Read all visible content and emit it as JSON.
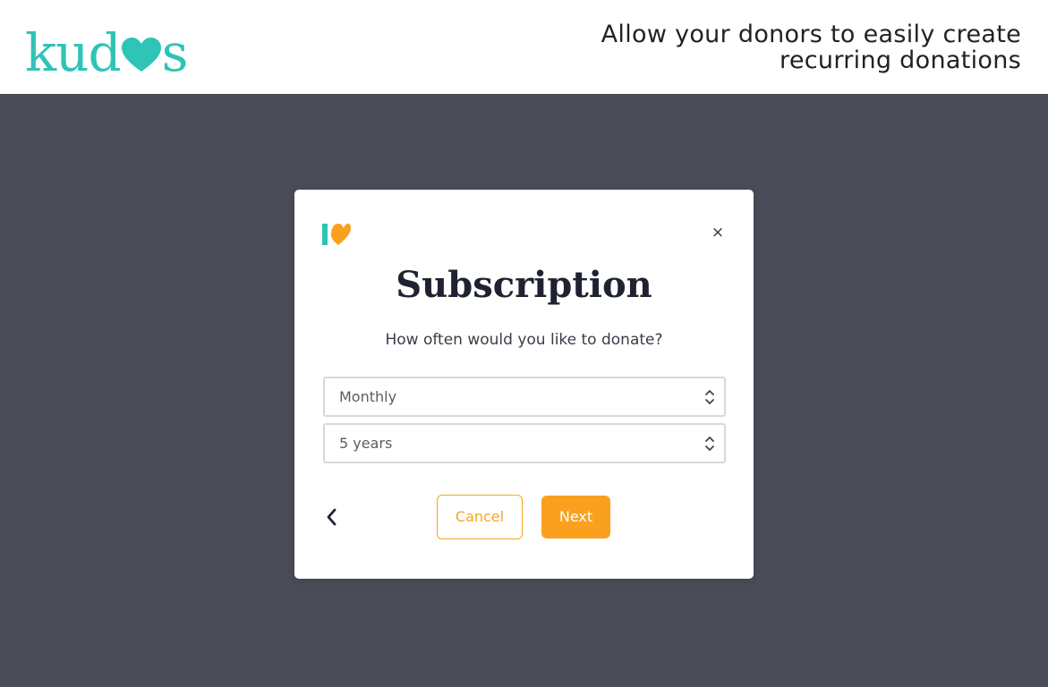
{
  "header": {
    "brand_prefix": "kud",
    "brand_suffix": "s",
    "tagline_line1": "Allow your donors to easily create",
    "tagline_line2": "recurring donations"
  },
  "colors": {
    "brand_teal": "#2ec4b6",
    "accent_orange": "#f9a11f",
    "backdrop": "#4a4d57"
  },
  "modal": {
    "close_glyph": "×",
    "title": "Subscription",
    "question": "How often would you like to donate?",
    "frequency_select": {
      "value": "Monthly"
    },
    "duration_select": {
      "value": "5 years"
    },
    "cancel_label": "Cancel",
    "next_label": "Next",
    "icons": {
      "brand": "kudos-mini-logo-icon",
      "close": "close-icon",
      "back": "chevron-left-icon",
      "select": "chevron-up-down-icon"
    }
  }
}
